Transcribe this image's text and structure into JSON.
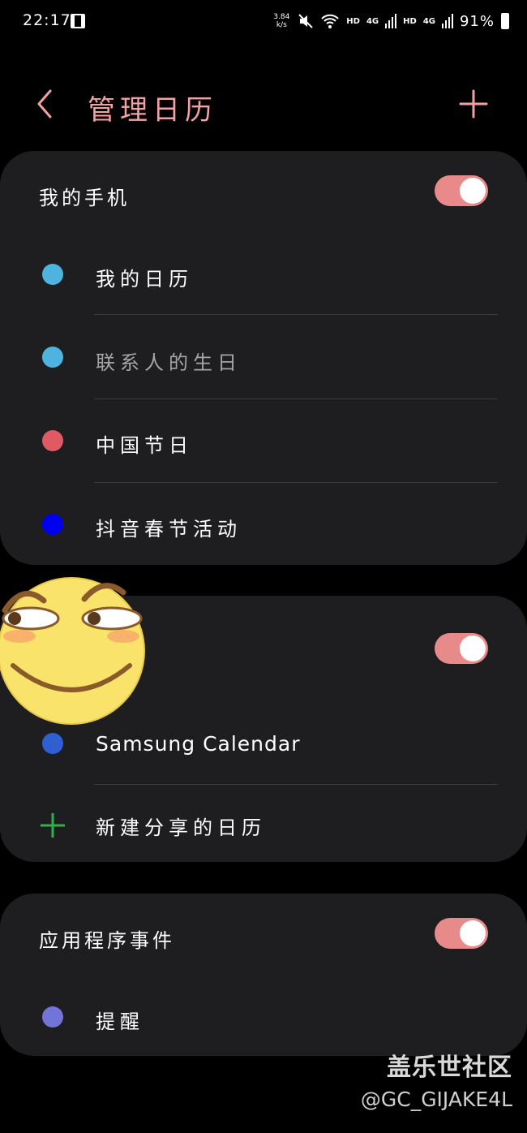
{
  "status_bar": {
    "time": "22:17",
    "speed_value": "3.84",
    "speed_unit": "k/s",
    "hd1": "HD",
    "net1": "4G",
    "hd2": "HD",
    "net2": "4G",
    "battery_percent": "91%"
  },
  "header": {
    "title": "管理日历",
    "back_icon": "chevron-left-icon",
    "add_icon": "plus-icon"
  },
  "colors": {
    "accent": "#f2a2a2",
    "toggle_on": "#e88a8a",
    "card_bg": "#1e1e20"
  },
  "my_phone": {
    "header": "我的手机",
    "toggle_on": true,
    "calendars": [
      {
        "label": "我的日历",
        "color": "#4fb3e0"
      },
      {
        "label": "联系人的生日",
        "color": "#4fb3e0"
      },
      {
        "label": "中国节日",
        "color": "#e05a63"
      },
      {
        "label": "抖音春节活动",
        "color": "#0000f0"
      }
    ]
  },
  "samsung": {
    "toggle_on": true,
    "calendars": [
      {
        "label": "Samsung Calendar",
        "color": "#2f5fd0"
      }
    ],
    "add_shared_label": "新建分享的日历"
  },
  "app_events": {
    "header": "应用程序事件",
    "toggle_on": true,
    "calendars": [
      {
        "label": "提醒",
        "color": "#7275d8"
      }
    ]
  },
  "watermark": {
    "site": "盖乐世社区",
    "handle": "@GC_GIJAKE4L"
  }
}
